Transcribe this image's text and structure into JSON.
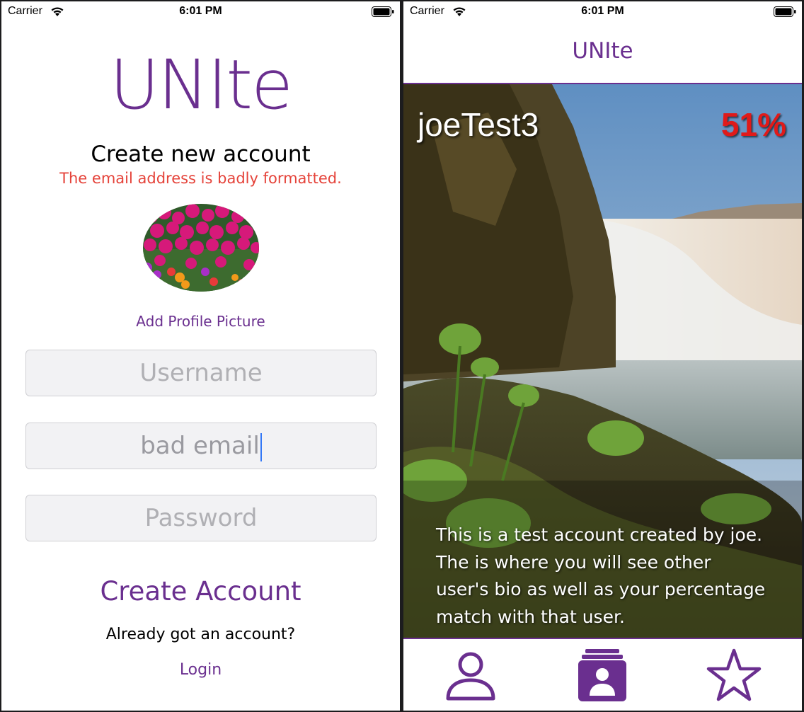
{
  "status_bar": {
    "carrier": "Carrier",
    "time": "6:01 PM"
  },
  "signup": {
    "logo": "UNIte",
    "heading": "Create new account",
    "error": "The email address is badly formatted.",
    "add_picture": "Add Profile Picture",
    "username_placeholder": "Username",
    "email_value": "bad email",
    "password_placeholder": "Password",
    "create_button": "Create Account",
    "already_text": "Already got an account?",
    "login_link": "Login"
  },
  "match": {
    "nav_title": "UNIte",
    "card": {
      "username": "joeTest3",
      "percent": "51%",
      "bio": "This is a test account created by joe. The is where you will see other user's bio as well as your percentage match with that user."
    },
    "tabs": [
      {
        "icon": "person-icon"
      },
      {
        "icon": "contact-cards-icon"
      },
      {
        "icon": "star-icon"
      }
    ]
  },
  "colors": {
    "brand": "#6a2f8f",
    "error": "#e5433a",
    "match_percent": "#e01a1a"
  }
}
